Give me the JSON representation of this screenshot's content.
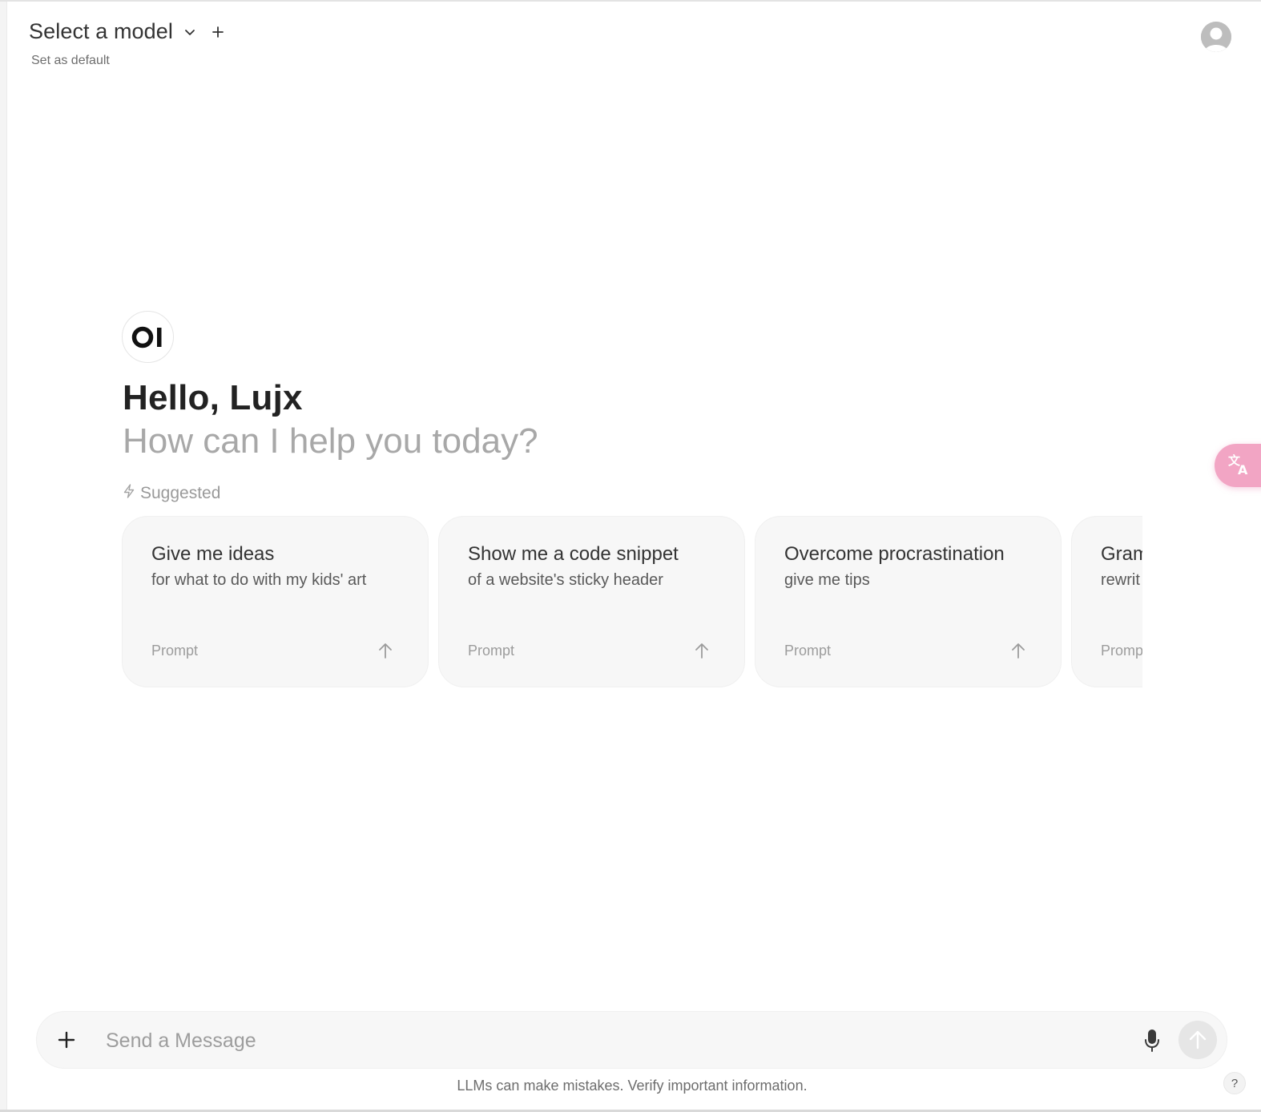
{
  "header": {
    "model_selector_label": "Select a model",
    "set_default_label": "Set as default"
  },
  "hero": {
    "logo_text": "OI",
    "greeting": "Hello, Lujx",
    "subtitle": "How can I help you today?",
    "suggested_label": "Suggested"
  },
  "suggestions": [
    {
      "title": "Give me ideas",
      "subtitle": "for what to do with my kids' art",
      "type": "Prompt"
    },
    {
      "title": "Show me a code snippet",
      "subtitle": "of a website's sticky header",
      "type": "Prompt"
    },
    {
      "title": "Overcome procrastination",
      "subtitle": "give me tips",
      "type": "Prompt"
    },
    {
      "title": "Gram",
      "subtitle": "rewrit",
      "type": "Promp"
    }
  ],
  "translate_fab": {
    "glyph": "文A"
  },
  "composer": {
    "placeholder": "Send a Message",
    "value": ""
  },
  "footer": {
    "disclaimer": "LLMs can make mistakes. Verify important information.",
    "help_label": "?"
  },
  "colors": {
    "card_bg": "#f7f7f7",
    "muted_text": "#a8a8a8",
    "translate_pink": "#f2a5c4"
  },
  "icons": [
    "chevron-down-icon",
    "plus-icon",
    "user-avatar-icon",
    "bolt-icon",
    "arrow-up-icon",
    "translate-icon",
    "microphone-icon",
    "send-icon",
    "help-icon"
  ]
}
